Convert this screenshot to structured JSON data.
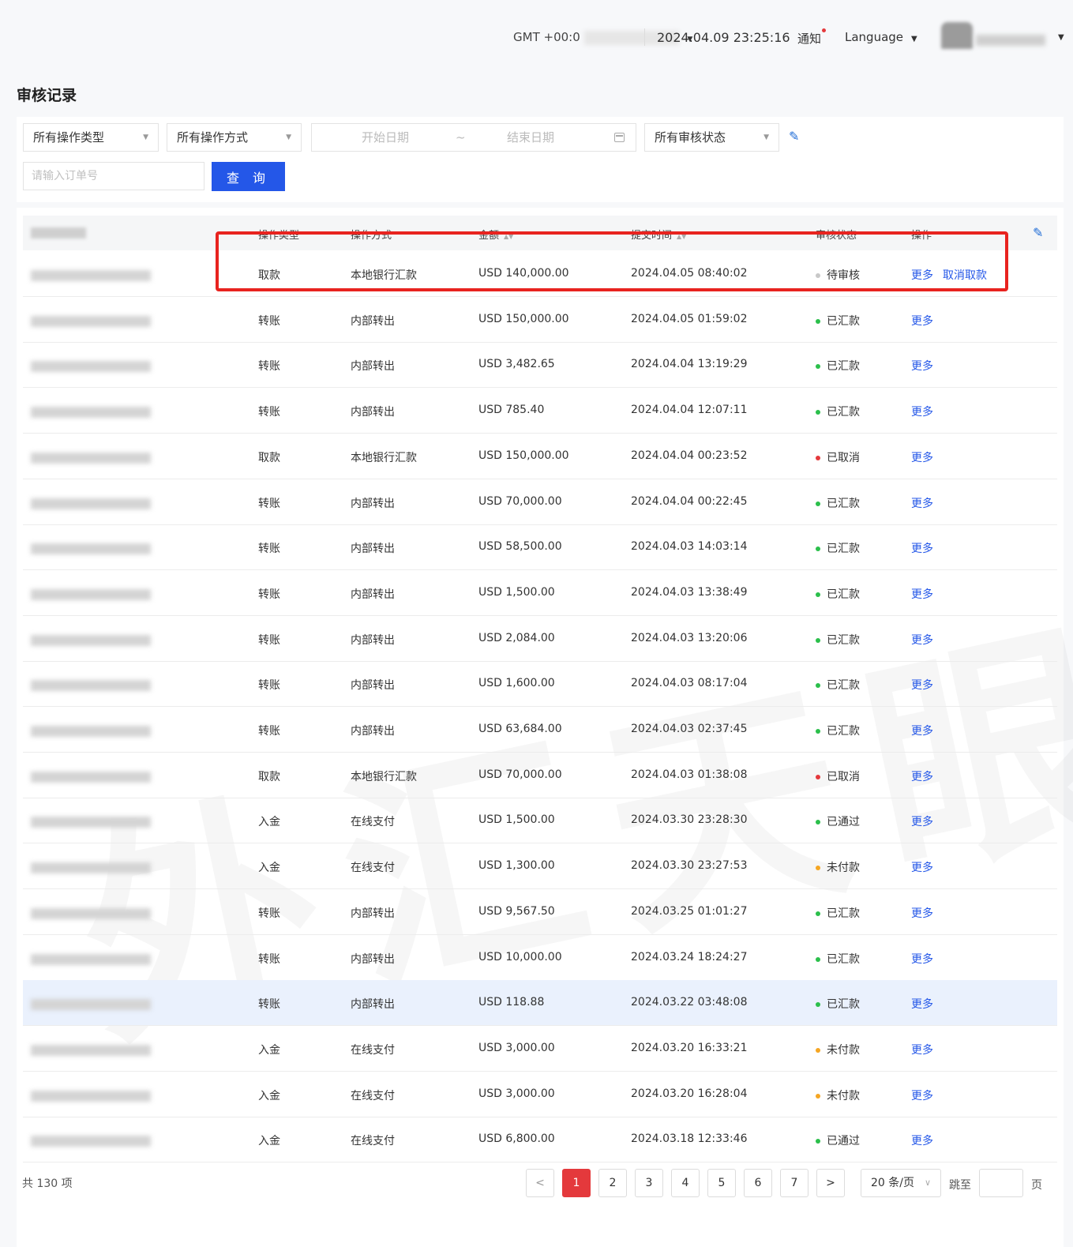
{
  "header": {
    "timezone_label": "GMT +00:0",
    "datetime": "2024.04.09 23:25:16",
    "notice_label": "通知",
    "language_label": "Language"
  },
  "page_title": "审核记录",
  "filters": {
    "operation_type": "所有操作类型",
    "operation_method": "所有操作方式",
    "start_date_placeholder": "开始日期",
    "date_separator": "~",
    "end_date_placeholder": "结束日期",
    "review_status": "所有审核状态",
    "order_placeholder": "请输入订单号",
    "query_label": "查 询"
  },
  "table": {
    "columns": [
      "操作类型",
      "操作方式",
      "金额",
      "提交时间",
      "审核状态",
      "操作"
    ],
    "rows": [
      {
        "type": "取款",
        "method": "本地银行汇款",
        "amount": "USD 140,000.00",
        "time": "2024.04.05 08:40:02",
        "status": "待审核",
        "status_color": "#c8c8c8",
        "action": "更多",
        "action2": "取消取款"
      },
      {
        "type": "转账",
        "method": "内部转出",
        "amount": "USD 150,000.00",
        "time": "2024.04.05 01:59:02",
        "status": "已汇款",
        "status_color": "#2bbf4b",
        "action": "更多"
      },
      {
        "type": "转账",
        "method": "内部转出",
        "amount": "USD 3,482.65",
        "time": "2024.04.04 13:19:29",
        "status": "已汇款",
        "status_color": "#2bbf4b",
        "action": "更多"
      },
      {
        "type": "转账",
        "method": "内部转出",
        "amount": "USD 785.40",
        "time": "2024.04.04 12:07:11",
        "status": "已汇款",
        "status_color": "#2bbf4b",
        "action": "更多"
      },
      {
        "type": "取款",
        "method": "本地银行汇款",
        "amount": "USD 150,000.00",
        "time": "2024.04.04 00:23:52",
        "status": "已取消",
        "status_color": "#e4393c",
        "action": "更多"
      },
      {
        "type": "转账",
        "method": "内部转出",
        "amount": "USD 70,000.00",
        "time": "2024.04.04 00:22:45",
        "status": "已汇款",
        "status_color": "#2bbf4b",
        "action": "更多"
      },
      {
        "type": "转账",
        "method": "内部转出",
        "amount": "USD 58,500.00",
        "time": "2024.04.03 14:03:14",
        "status": "已汇款",
        "status_color": "#2bbf4b",
        "action": "更多"
      },
      {
        "type": "转账",
        "method": "内部转出",
        "amount": "USD 1,500.00",
        "time": "2024.04.03 13:38:49",
        "status": "已汇款",
        "status_color": "#2bbf4b",
        "action": "更多"
      },
      {
        "type": "转账",
        "method": "内部转出",
        "amount": "USD 2,084.00",
        "time": "2024.04.03 13:20:06",
        "status": "已汇款",
        "status_color": "#2bbf4b",
        "action": "更多"
      },
      {
        "type": "转账",
        "method": "内部转出",
        "amount": "USD 1,600.00",
        "time": "2024.04.03 08:17:04",
        "status": "已汇款",
        "status_color": "#2bbf4b",
        "action": "更多"
      },
      {
        "type": "转账",
        "method": "内部转出",
        "amount": "USD 63,684.00",
        "time": "2024.04.03 02:37:45",
        "status": "已汇款",
        "status_color": "#2bbf4b",
        "action": "更多"
      },
      {
        "type": "取款",
        "method": "本地银行汇款",
        "amount": "USD 70,000.00",
        "time": "2024.04.03 01:38:08",
        "status": "已取消",
        "status_color": "#e4393c",
        "action": "更多"
      },
      {
        "type": "入金",
        "method": "在线支付",
        "amount": "USD 1,500.00",
        "time": "2024.03.30 23:28:30",
        "status": "已通过",
        "status_color": "#2bbf4b",
        "action": "更多"
      },
      {
        "type": "入金",
        "method": "在线支付",
        "amount": "USD 1,300.00",
        "time": "2024.03.30 23:27:53",
        "status": "未付款",
        "status_color": "#f5a623",
        "action": "更多"
      },
      {
        "type": "转账",
        "method": "内部转出",
        "amount": "USD 9,567.50",
        "time": "2024.03.25 01:01:27",
        "status": "已汇款",
        "status_color": "#2bbf4b",
        "action": "更多"
      },
      {
        "type": "转账",
        "method": "内部转出",
        "amount": "USD 10,000.00",
        "time": "2024.03.24 18:24:27",
        "status": "已汇款",
        "status_color": "#2bbf4b",
        "action": "更多"
      },
      {
        "type": "转账",
        "method": "内部转出",
        "amount": "USD 118.88",
        "time": "2024.03.22 03:48:08",
        "status": "已汇款",
        "status_color": "#2bbf4b",
        "action": "更多",
        "highlighted": true
      },
      {
        "type": "入金",
        "method": "在线支付",
        "amount": "USD 3,000.00",
        "time": "2024.03.20 16:33:21",
        "status": "未付款",
        "status_color": "#f5a623",
        "action": "更多"
      },
      {
        "type": "入金",
        "method": "在线支付",
        "amount": "USD 3,000.00",
        "time": "2024.03.20 16:28:04",
        "status": "未付款",
        "status_color": "#f5a623",
        "action": "更多"
      },
      {
        "type": "入金",
        "method": "在线支付",
        "amount": "USD 6,800.00",
        "time": "2024.03.18 12:33:46",
        "status": "已通过",
        "status_color": "#2bbf4b",
        "action": "更多"
      }
    ]
  },
  "footer": {
    "total": "共 130 项",
    "pages": [
      "1",
      "2",
      "3",
      "4",
      "5",
      "6",
      "7"
    ],
    "prev_label": "<",
    "next_label": ">",
    "page_size": "20 条/页",
    "goto_label": "跳至",
    "page_unit": "页"
  },
  "watermark": "外汇天眼"
}
